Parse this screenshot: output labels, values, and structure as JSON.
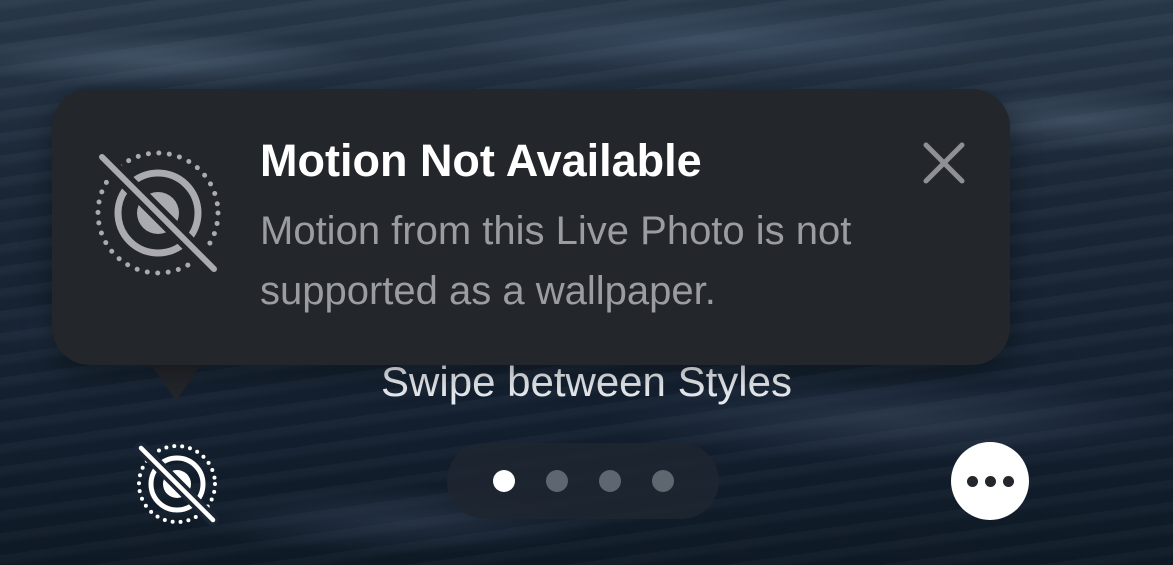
{
  "toast": {
    "icon": "live-photo-off-icon",
    "title": "Motion Not Available",
    "message": "Motion from this Live Photo is not supported as a wallpaper.",
    "close_icon": "close-icon",
    "background_color": "#23262b"
  },
  "hint": {
    "text": "Swipe between Styles"
  },
  "controls": {
    "live_photo_toggle_icon": "live-photo-off-icon",
    "more_button_icon": "ellipsis-icon",
    "pager": {
      "page_count": 4,
      "current_page": 1
    }
  }
}
